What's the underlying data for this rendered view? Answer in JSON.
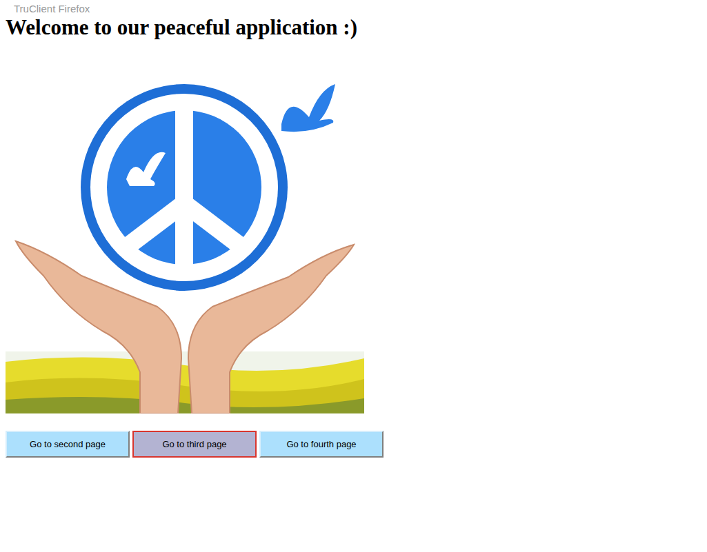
{
  "browser_label": "TruClient Firefox",
  "heading": "Welcome to our peaceful application :)",
  "buttons": [
    {
      "label": "Go to second page",
      "selected": false
    },
    {
      "label": "Go to third page",
      "selected": true
    },
    {
      "label": "Go to fourth page",
      "selected": false
    }
  ]
}
